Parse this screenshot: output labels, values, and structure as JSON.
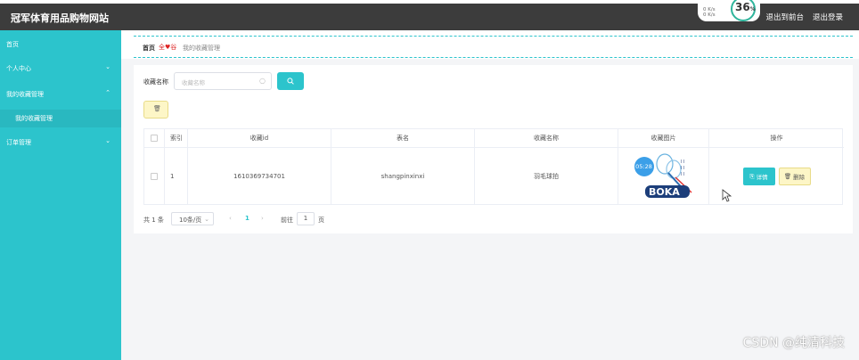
{
  "header": {
    "site_title": "冠军体育用品购物网站",
    "actions": [
      "退出到前台",
      "退出登录"
    ],
    "speed_widget": {
      "up": "0 K/s",
      "down": "0 K/s",
      "percent": "36",
      "unit": "%"
    }
  },
  "sidebar": {
    "items": [
      {
        "label": "首页",
        "arrow": ""
      },
      {
        "label": "个人中心",
        "arrow": "⌄"
      },
      {
        "label": "我的收藏管理",
        "arrow": "⌃"
      },
      {
        "label": "我的收藏管理",
        "arrow": ""
      },
      {
        "label": "订单管理",
        "arrow": "⌄"
      }
    ]
  },
  "breadcrumb": {
    "home": "首页",
    "separator": "♥",
    "current": "我的收藏管理"
  },
  "search": {
    "label": "收藏名称",
    "placeholder": "收藏名称"
  },
  "table": {
    "headers": [
      "索引",
      "收藏id",
      "表名",
      "收藏名称",
      "收藏图片",
      "操作"
    ],
    "rows": [
      {
        "index": "1",
        "id": "1610369734701",
        "table_name": "shangpinxinxi",
        "name": "羽毛球拍",
        "image_time": "05:28"
      }
    ],
    "detail_label": "详情",
    "delete_label": "删除"
  },
  "pagination": {
    "total": "共 1 条",
    "page_size": "10条/页",
    "current_page": "1",
    "goto_label": "前往",
    "goto_value": "1",
    "page_suffix": "页"
  },
  "watermark": "CSDN @纯清科技",
  "colors": {
    "accent": "#2cc4cc",
    "topbar": "#3c3c3c",
    "delete_bg": "#fdf6c7"
  }
}
